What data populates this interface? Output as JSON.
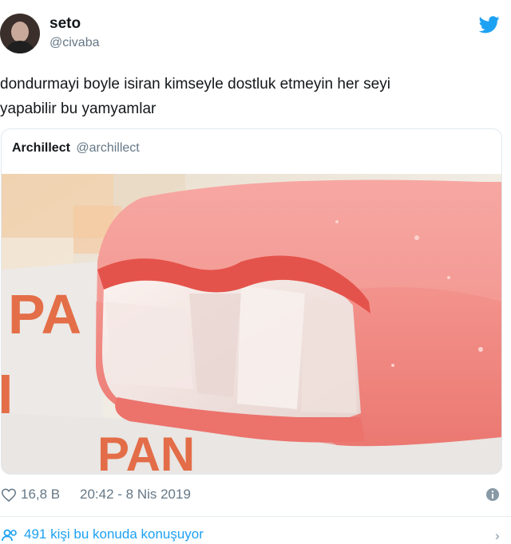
{
  "tweet": {
    "author_name": "seto",
    "author_handle": "@civaba",
    "text_line1": "dondurmayi boyle isiran kimseyle dostluk etmeyin her seyi",
    "text_line2": "yapabilir bu yamyamlar"
  },
  "quoted_tweet": {
    "author_name": "Archillect",
    "author_handle": "@archillect",
    "image_alt": "Bitten strawberry ice cream bar on wrapper"
  },
  "meta": {
    "likes": "16,8 B",
    "timestamp": "20:42 - 8 Nis 2019"
  },
  "footer": {
    "text": "491 kişi bu konuda konuşuyor"
  },
  "icons": {
    "brand": "twitter-bird-icon",
    "like": "heart-icon",
    "info": "info-icon",
    "people": "people-icon",
    "chevron": "chevron-right-icon"
  },
  "colors": {
    "twitter_blue": "#1da1f2",
    "secondary_text": "#657786"
  }
}
